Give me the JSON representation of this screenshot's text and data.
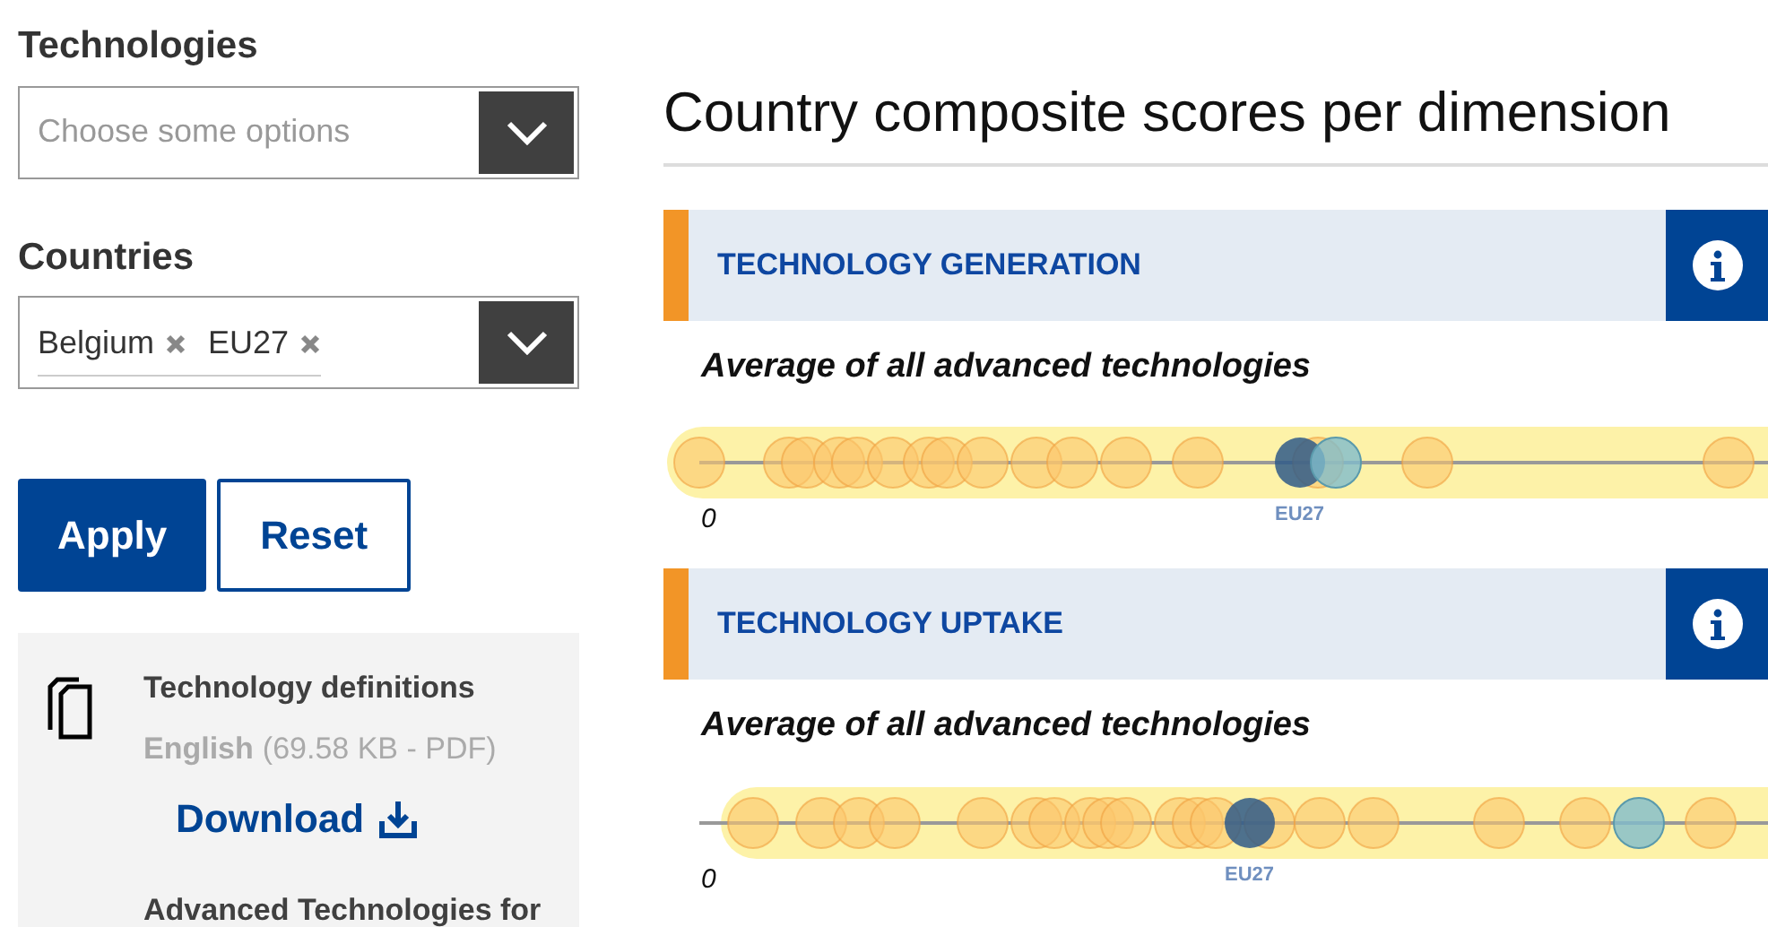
{
  "filters": [
    {
      "label": "Technologies",
      "placeholder": "Choose some options"
    },
    {
      "label": "Countries",
      "tags": [
        "Belgium",
        "EU27"
      ]
    }
  ],
  "buttons": [
    {
      "label": "Apply",
      "kind": "primary"
    },
    {
      "label": "Reset",
      "kind": "secondary"
    }
  ],
  "download": {
    "title": "Technology definitions",
    "language": "English",
    "size": "(69.58 KB - PDF)",
    "link": "Download",
    "next_title": "Advanced Technologies for"
  },
  "heading": "Country composite scores per dimension",
  "sections": [
    {
      "title": "TECHNOLOGY GENERATION",
      "subtitle": "Average of all advanced technologies",
      "axis_label": "0",
      "marker_label": "EU27"
    },
    {
      "title": "TECHNOLOGY UPTAKE",
      "subtitle": "Average of all advanced technologies",
      "axis_label": "0",
      "marker_label": "EU27"
    }
  ]
}
